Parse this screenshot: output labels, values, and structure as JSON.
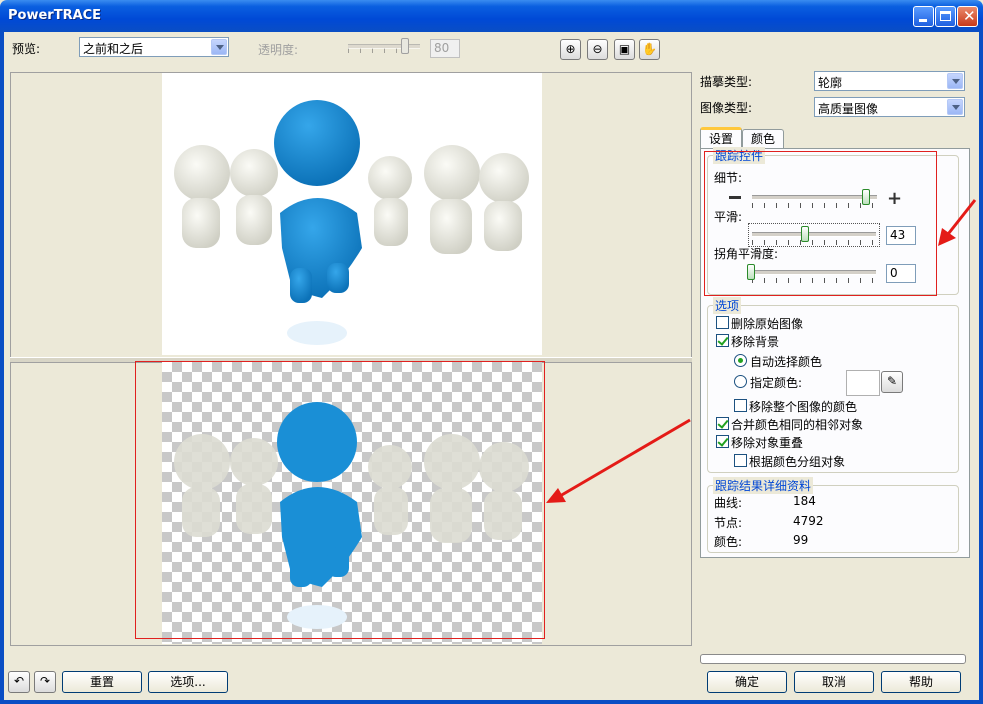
{
  "window": {
    "title": "PowerTRACE"
  },
  "toolbar": {
    "preview_label": "预览:",
    "preview_mode": "之前和之后",
    "transparency_label": "透明度:",
    "transparency_value": "80"
  },
  "right": {
    "trace_type_label": "描摹类型:",
    "trace_type_value": "轮廓",
    "image_type_label": "图像类型:",
    "image_type_value": "高质量图像",
    "tabs": [
      "设置",
      "颜色"
    ],
    "trace_controls": {
      "title": "跟踪控件",
      "detail_label": "细节:",
      "detail_level": 0.9,
      "smoothing_label": "平滑:",
      "smoothing_value": "43",
      "corner_label": "拐角平滑度:",
      "corner_value": "0"
    },
    "options": {
      "title": "选项",
      "delete_original": "删除原始图像",
      "remove_background": "移除背景",
      "auto_color": "自动选择颜色",
      "specify_color": "指定颜色:",
      "remove_whole_color": "移除整个图像的颜色",
      "merge_adjacent": "合并颜色相同的相邻对象",
      "remove_overlap": "移除对象重叠",
      "group_by_color": "根据颜色分组对象"
    },
    "details": {
      "title": "跟踪结果详细资料",
      "curves_label": "曲线:",
      "curves_value": "184",
      "nodes_label": "节点:",
      "nodes_value": "4792",
      "colors_label": "颜色:",
      "colors_value": "99"
    }
  },
  "bottom": {
    "reset": "重置",
    "options": "选项...",
    "ok": "确定",
    "cancel": "取消",
    "help": "帮助"
  },
  "colors": {
    "accent_red": "#e41b17",
    "figure_blue": "#1a8fd6",
    "title_blue": "#0049d6"
  }
}
